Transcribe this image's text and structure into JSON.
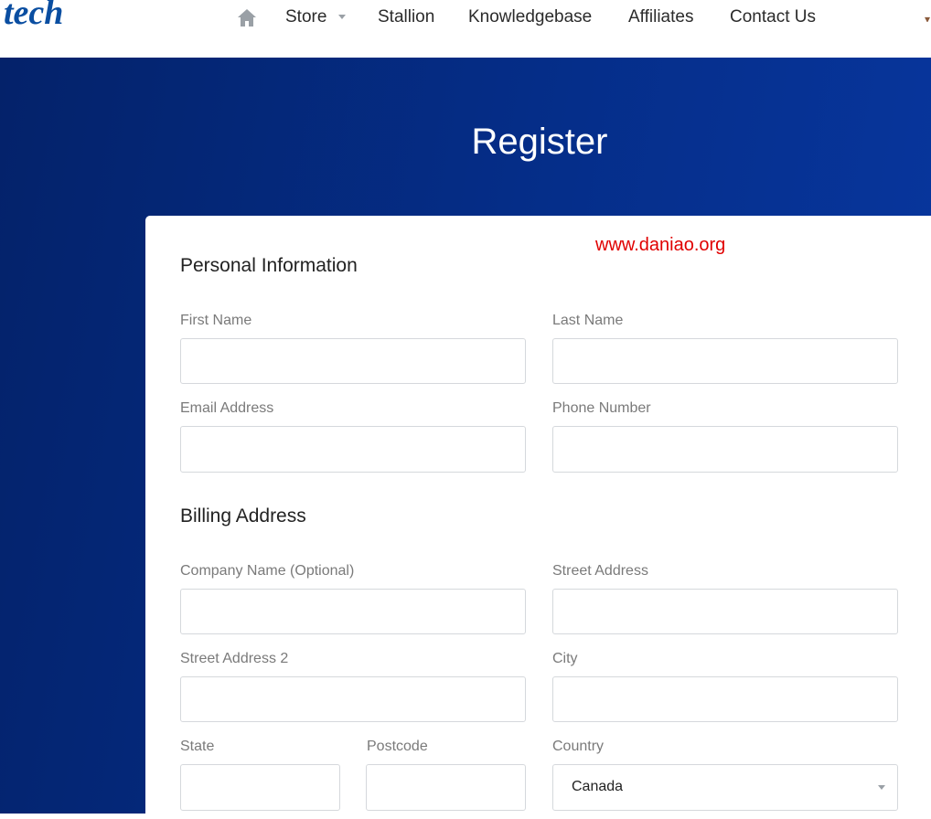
{
  "header": {
    "logo_text": "tech",
    "nav": {
      "home_icon": "home-icon",
      "store": "Store",
      "stallion": "Stallion",
      "knowledgebase": "Knowledgebase",
      "affiliates": "Affiliates",
      "contact": "Contact Us"
    }
  },
  "page": {
    "title": "Register",
    "watermark": "www.daniao.org"
  },
  "personal": {
    "heading": "Personal Information",
    "first_name_label": "First Name",
    "last_name_label": "Last Name",
    "email_label": "Email Address",
    "phone_label": "Phone Number"
  },
  "billing": {
    "heading": "Billing Address",
    "company_label": "Company Name (Optional)",
    "street_label": "Street Address",
    "street2_label": "Street Address 2",
    "city_label": "City",
    "state_label": "State",
    "postcode_label": "Postcode",
    "country_label": "Country",
    "country_value": "Canada"
  },
  "colors": {
    "hero_start": "#04226a",
    "hero_end": "#0837a0",
    "logo": "#0a4ea1",
    "watermark": "#e00000"
  }
}
